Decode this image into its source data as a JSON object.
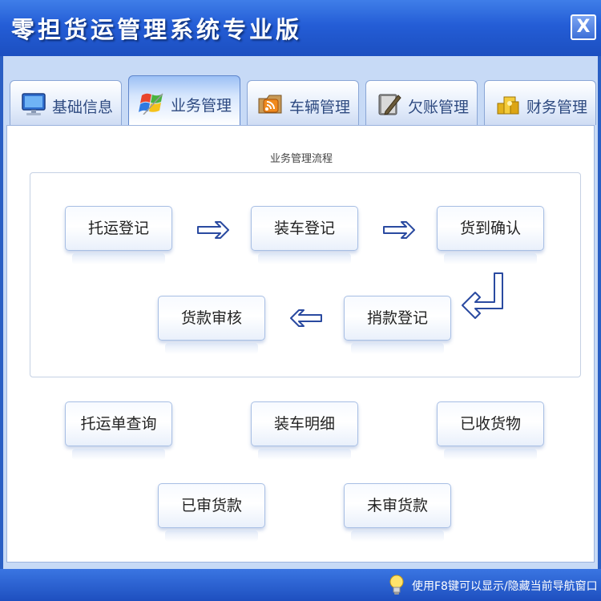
{
  "window": {
    "title": "零担货运管理系统专业版",
    "close_label": "X"
  },
  "tabs": [
    {
      "label": "基础信息",
      "icon": "monitor-icon",
      "active": false
    },
    {
      "label": "业务管理",
      "icon": "windows-flag-icon",
      "active": true
    },
    {
      "label": "车辆管理",
      "icon": "rss-folder-icon",
      "active": false
    },
    {
      "label": "欠账管理",
      "icon": "notebook-pen-icon",
      "active": false
    },
    {
      "label": "财务管理",
      "icon": "gold-coins-icon",
      "active": false
    }
  ],
  "flow": {
    "title": "业务管理流程",
    "steps": {
      "consign_register": "托运登记",
      "loading_register": "装车登记",
      "arrival_confirm": "货到确认",
      "remit_register": "捎款登记",
      "payment_review": "货款审核"
    }
  },
  "quick_buttons": {
    "consign_query": "托运单查询",
    "loading_detail": "装车明细",
    "goods_received": "已收货物",
    "payment_reviewed": "已审货款",
    "payment_unreviewed": "未审货款"
  },
  "status": {
    "hint": "使用F8键可以显示/隐藏当前导航窗口",
    "hint_icon": "lightbulb-icon"
  },
  "colors": {
    "titlebar": "#245dd6",
    "window_bg": "#c7daf6",
    "tab_text": "#2e4a80",
    "arrow_stroke": "#2a4aa0"
  }
}
